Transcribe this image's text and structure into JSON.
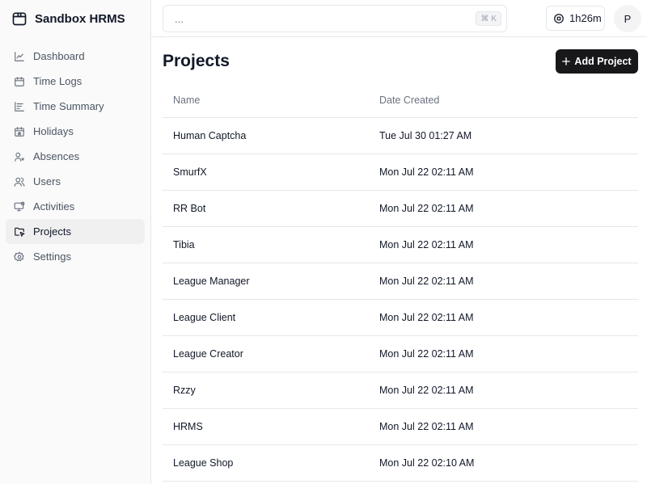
{
  "app": {
    "name": "Sandbox HRMS"
  },
  "sidebar": {
    "items": [
      {
        "label": "Dashboard",
        "icon": "chart-line-icon"
      },
      {
        "label": "Time Logs",
        "icon": "calendar-icon"
      },
      {
        "label": "Time Summary",
        "icon": "bar-chart-icon"
      },
      {
        "label": "Holidays",
        "icon": "calendar-star-icon"
      },
      {
        "label": "Absences",
        "icon": "user-x-icon"
      },
      {
        "label": "Users",
        "icon": "users-icon"
      },
      {
        "label": "Activities",
        "icon": "monitor-activity-icon"
      },
      {
        "label": "Projects",
        "icon": "folder-cursor-icon",
        "active": true
      },
      {
        "label": "Settings",
        "icon": "gear-icon"
      }
    ]
  },
  "topbar": {
    "search_placeholder": "...",
    "shortcut_symbol": "⌘",
    "shortcut_key": "K",
    "timer": "1h26m",
    "avatar_initial": "P"
  },
  "main": {
    "title": "Projects",
    "add_button": "Add Project",
    "columns": {
      "name": "Name",
      "date": "Date Created"
    },
    "rows": [
      {
        "name": "Human Captcha",
        "date": "Tue Jul 30 01:27 AM"
      },
      {
        "name": "SmurfX",
        "date": "Mon Jul 22 02:11 AM"
      },
      {
        "name": "RR Bot",
        "date": "Mon Jul 22 02:11 AM"
      },
      {
        "name": "Tibia",
        "date": "Mon Jul 22 02:11 AM"
      },
      {
        "name": "League Manager",
        "date": "Mon Jul 22 02:11 AM"
      },
      {
        "name": "League Client",
        "date": "Mon Jul 22 02:11 AM"
      },
      {
        "name": "League Creator",
        "date": "Mon Jul 22 02:11 AM"
      },
      {
        "name": "Rzzy",
        "date": "Mon Jul 22 02:11 AM"
      },
      {
        "name": "HRMS",
        "date": "Mon Jul 22 02:11 AM"
      },
      {
        "name": "League Shop",
        "date": "Mon Jul 22 02:10 AM"
      }
    ]
  },
  "colors": {
    "accent": "#18181b",
    "border": "#e5e7eb",
    "sidebar_bg": "#fafafa",
    "active_bg": "#f0f0f1"
  }
}
